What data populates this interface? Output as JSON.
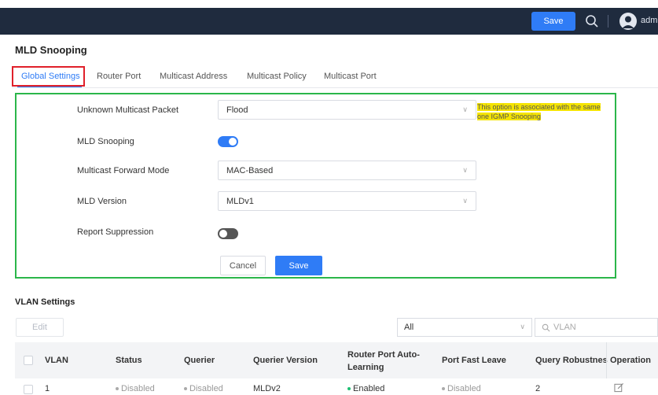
{
  "topbar": {
    "save_label": "Save",
    "user_label": "adm"
  },
  "page": {
    "title": "MLD Snooping"
  },
  "tabs": [
    {
      "label": "Global Settings",
      "active": true
    },
    {
      "label": "Router Port",
      "active": false
    },
    {
      "label": "Multicast Address",
      "active": false
    },
    {
      "label": "Multicast Policy",
      "active": false
    },
    {
      "label": "Multicast Port",
      "active": false
    }
  ],
  "form": {
    "unknown_multicast": {
      "label": "Unknown Multicast Packet",
      "value": "Flood"
    },
    "mld_snooping": {
      "label": "MLD Snooping",
      "enabled": true
    },
    "forward_mode": {
      "label": "Multicast Forward Mode",
      "value": "MAC-Based"
    },
    "mld_version": {
      "label": "MLD Version",
      "value": "MLDv1"
    },
    "report_suppression": {
      "label": "Report Suppression",
      "enabled": false
    },
    "hint_line1": "This option is associated with the same",
    "hint_line2": "one IGMP Snooping",
    "cancel_label": "Cancel",
    "save_label": "Save"
  },
  "vlan": {
    "section_title": "VLAN Settings",
    "edit_label": "Edit",
    "filter_value": "All",
    "search_placeholder": "VLAN",
    "columns": {
      "vlan": "VLAN",
      "status": "Status",
      "querier": "Querier",
      "querier_version": "Querier Version",
      "router_port_line1": "Router Port Auto-",
      "router_port_line2": "Learning",
      "port_fast_leave": "Port Fast Leave",
      "query_robustness": "Query Robustnes",
      "operation": "Operation"
    },
    "rows": [
      {
        "vlan": "1",
        "status": "Disabled",
        "querier": "Disabled",
        "querier_version": "MLDv2",
        "router_port_auto_learning": "Enabled",
        "port_fast_leave": "Disabled",
        "query_robustness": "2"
      }
    ]
  },
  "colors": {
    "accent": "#2f7cf6",
    "topbar": "#1f2b3e",
    "highlight_red": "#e0202a",
    "highlight_green": "#2bb64a",
    "hint_yellow": "#f5e400",
    "status_enabled": "#1dbf73"
  }
}
